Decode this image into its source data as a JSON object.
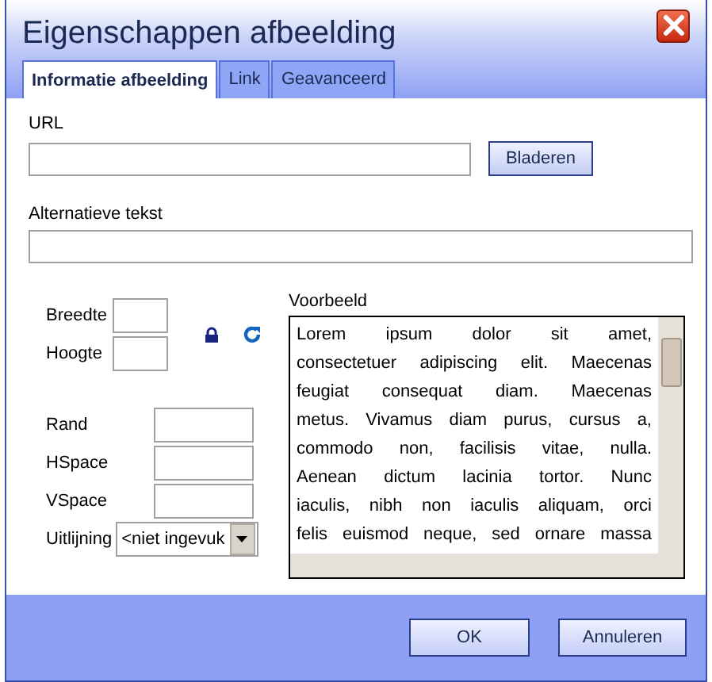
{
  "window": {
    "title": "Eigenschappen afbeelding"
  },
  "tabs": [
    {
      "label": "Informatie afbeelding",
      "selected": true
    },
    {
      "label": "Link",
      "selected": false
    },
    {
      "label": "Geavanceerd",
      "selected": false
    }
  ],
  "url": {
    "label": "URL",
    "browse_button": "Bladeren"
  },
  "alt_text": {
    "label": "Alternatieve tekst"
  },
  "size_fields": [
    {
      "label": "Breedte"
    },
    {
      "label": "Hoogte"
    }
  ],
  "spacing_fields": [
    {
      "label": "Rand"
    },
    {
      "label": "HSpace"
    },
    {
      "label": "VSpace"
    }
  ],
  "alignment": {
    "label": "Uitlijning",
    "value": "<niet ingevuk"
  },
  "preview": {
    "label": "Voorbeeld",
    "lines": [
      "Lorem ipsum dolor sit amet,",
      "consectetuer adipiscing elit. Maecenas",
      "feugiat consequat diam. Maecenas",
      "metus. Vivamus diam purus, cursus a,",
      "commodo non, facilisis vitae, nulla.",
      "Aenean dictum lacinia tortor. Nunc",
      "iaculis, nibh non iaculis aliquam, orci",
      "felis euismod neque, sed ornare massa"
    ]
  },
  "buttons": [
    "OK",
    "Annuleren"
  ]
}
